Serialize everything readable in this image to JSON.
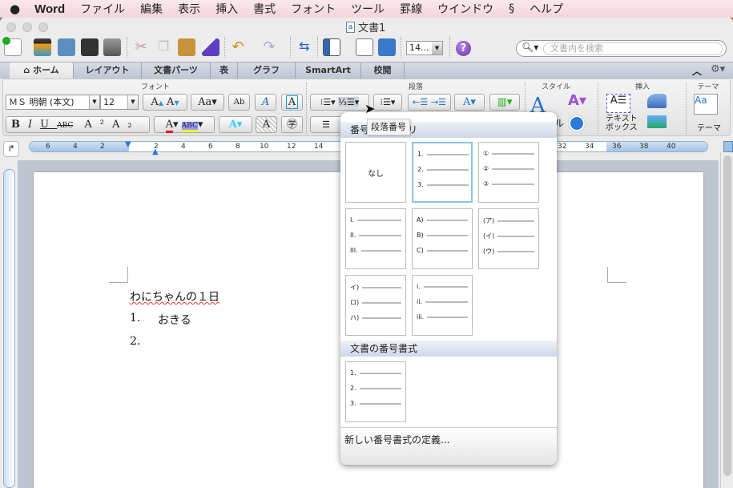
{
  "menubar": {
    "apple": "",
    "app": "Word",
    "items": [
      "ファイル",
      "編集",
      "表示",
      "挿入",
      "書式",
      "フォント",
      "ツール",
      "罫線",
      "ウインドウ",
      "ヘルプ"
    ]
  },
  "window": {
    "title": "文書1"
  },
  "toolbar": {
    "zoom": "14...",
    "search_placeholder": "文書内を検索",
    "help": "?"
  },
  "tabs": [
    "ホーム",
    "レイアウト",
    "文書パーツ",
    "表",
    "グラフ",
    "SmartArt",
    "校閲"
  ],
  "ribbon": {
    "groups": {
      "font": "フォント",
      "paragraph": "段落",
      "style": "スタイル",
      "insert": "挿入",
      "theme": "テーマ"
    },
    "font_name": "ＭＳ 明朝 (本文)",
    "font_size": "12",
    "textbox_label": "テキスト ボックス",
    "theme_label": "テーマ",
    "style_partial": "ル"
  },
  "ruler": {
    "numbers": [
      "6",
      "4",
      "2",
      "2",
      "4",
      "6",
      "8",
      "10",
      "12",
      "14",
      "32",
      "34",
      "36",
      "38",
      "40"
    ]
  },
  "document": {
    "lines": [
      {
        "text": "わにちゃんの１日"
      },
      {
        "num": "1.",
        "text": "おきる"
      },
      {
        "num": "2.",
        "text": ""
      }
    ]
  },
  "popup": {
    "tooltip": "段落番号",
    "library_header": "番号ライブラリ",
    "library": [
      {
        "none": "なし"
      },
      {
        "items": [
          "1.",
          "2.",
          "3."
        ],
        "selected": true
      },
      {
        "items": [
          "①",
          "②",
          "③"
        ]
      },
      {
        "items": [
          "I.",
          "II.",
          "III."
        ]
      },
      {
        "items": [
          "A)",
          "B)",
          "C)"
        ]
      },
      {
        "items": [
          "(ア)",
          "(イ)",
          "(ウ)"
        ]
      },
      {
        "items": [
          "イ)",
          "ロ)",
          "ハ)"
        ]
      },
      {
        "items": [
          "i.",
          "ii.",
          "iii."
        ]
      }
    ],
    "doc_header": "文書の番号書式",
    "doc_formats": [
      {
        "items": [
          "1.",
          "2.",
          "3."
        ]
      }
    ],
    "define_new": "新しい番号書式の定義..."
  }
}
